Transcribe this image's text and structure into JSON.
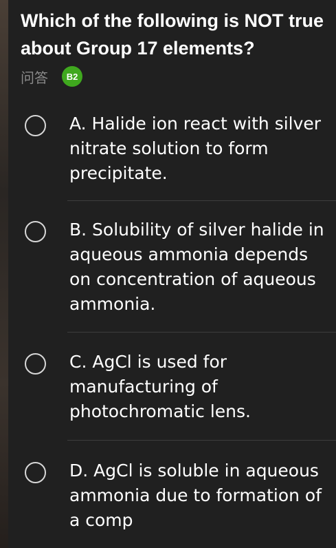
{
  "question": {
    "text": "Which of the following is NOT true about Group 17 elements?"
  },
  "meta": {
    "label": "问答",
    "badge": "B2",
    "badge_color": "#3fa81e"
  },
  "options": [
    {
      "text": "A. Halide ion react with silver nitrate solution to form precipitate.",
      "selected": false
    },
    {
      "text": "B. Solubility of silver halide in aqueous ammonia depends on concentration of aqueous ammonia.",
      "selected": false
    },
    {
      "text": "C. AgCl is used for manufacturing of photochromatic lens.",
      "selected": false
    },
    {
      "text": "D. AgCl is soluble in aqueous ammonia due to formation of a comp",
      "selected": false
    }
  ],
  "colors": {
    "background": "#202020",
    "text": "#ffffff",
    "muted": "#8a8a8a",
    "radio_border": "#d8d8d8",
    "divider": "#3d3d3d"
  }
}
